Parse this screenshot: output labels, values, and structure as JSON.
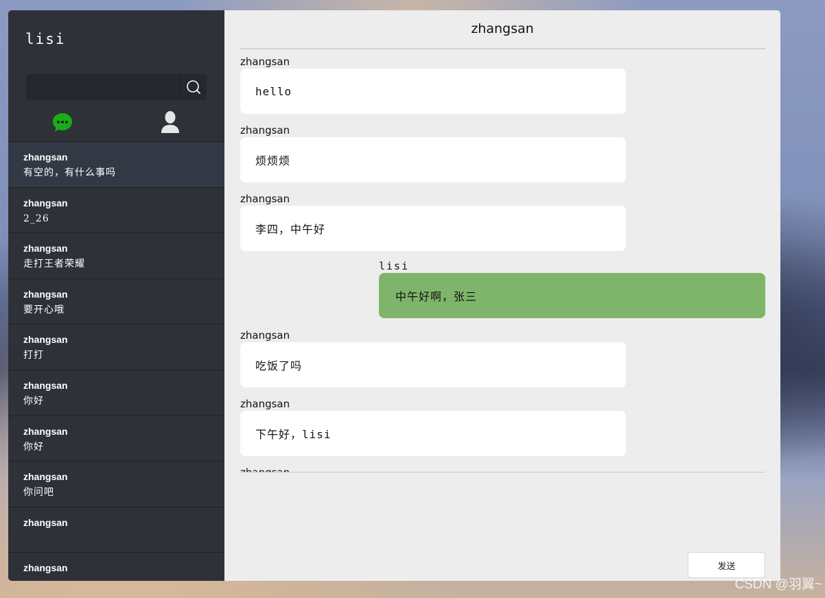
{
  "sidebar": {
    "user_name": "lisi",
    "search": {
      "value": ""
    },
    "tabs": [
      {
        "name": "sessions",
        "icon": "chat-bubble-icon",
        "color": "#1aad19",
        "active": true
      },
      {
        "name": "friends",
        "icon": "person-icon",
        "color": "#e6e6e6",
        "active": false
      }
    ],
    "sessions": [
      {
        "name": "zhangsan",
        "last_message": "有空的，有什么事吗"
      },
      {
        "name": "zhangsan",
        "last_message": "2_26"
      },
      {
        "name": "zhangsan",
        "last_message": "走打王者荣耀"
      },
      {
        "name": "zhangsan",
        "last_message": "要开心哦"
      },
      {
        "name": "zhangsan",
        "last_message": "打打"
      },
      {
        "name": "zhangsan",
        "last_message": "你好"
      },
      {
        "name": "zhangsan",
        "last_message": "你好"
      },
      {
        "name": "zhangsan",
        "last_message": "你问吧"
      },
      {
        "name": "zhangsan",
        "last_message": ""
      },
      {
        "name": "zhangsan",
        "last_message": ""
      }
    ]
  },
  "chat": {
    "title": "zhangsan",
    "messages": [
      {
        "author": "zhangsan",
        "text": "hello",
        "mine": false
      },
      {
        "author": "zhangsan",
        "text": "烦烦烦",
        "mine": false
      },
      {
        "author": "zhangsan",
        "text": "李四，中午好",
        "mine": false
      },
      {
        "author": "lisi",
        "text": "中午好啊，张三",
        "mine": true
      },
      {
        "author": "zhangsan",
        "text": "吃饭了吗",
        "mine": false
      },
      {
        "author": "zhangsan",
        "text": "下午好，lisi",
        "mine": false
      },
      {
        "author": "zhangsan",
        "text": "",
        "mine": false
      }
    ],
    "send_label": "发送"
  },
  "watermark": "CSDN @羽翼~",
  "colors": {
    "sidebar_bg": "#2e3138",
    "active_session_bg": "#323844",
    "chat_bg": "#ededed",
    "my_bubble": "#7eb56b",
    "other_bubble": "#ffffff"
  }
}
